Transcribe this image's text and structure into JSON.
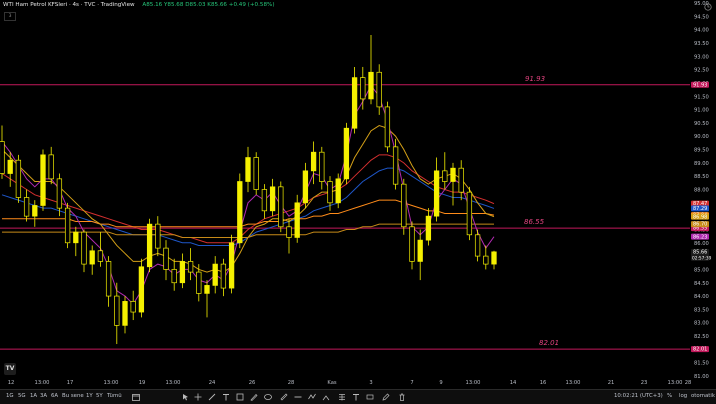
{
  "chart_info": {
    "title": "WTI Ham Petrol KFSleri · 4s · TVC · TradingView",
    "ohlc": "A85.16 Y85.68 D85.03 K85.66 +0.49 (+0.58%)"
  },
  "chart_data": {
    "type": "candlestick",
    "y_range": [
      81.0,
      95.0
    ],
    "y_ticks": [
      "95.00",
      "94.50",
      "94.00",
      "93.50",
      "93.00",
      "92.50",
      "92.00",
      "91.50",
      "91.00",
      "90.50",
      "90.00",
      "89.50",
      "89.00",
      "88.50",
      "88.00",
      "87.50",
      "87.00",
      "86.50",
      "86.00",
      "85.50",
      "85.00",
      "84.50",
      "84.00",
      "83.50",
      "83.00",
      "82.50",
      "82.00",
      "81.50",
      "81.00"
    ],
    "x_ticks": [
      "12",
      "13:00",
      "17",
      "13:00",
      "19",
      "13:00",
      "24",
      "26",
      "28",
      "Kas",
      "3",
      "7",
      "9",
      "13:00",
      "14",
      "16",
      "13:00",
      "21",
      "23",
      "13:00",
      "28"
    ],
    "horizontal_levels": [
      {
        "label": "91.93",
        "value": 91.93
      },
      {
        "label": "86.55",
        "value": 86.55
      },
      {
        "label": "82.01",
        "value": 82.01
      }
    ],
    "price_tags": [
      {
        "label": "87.47",
        "value": 87.47,
        "color": "#d32f2f"
      },
      {
        "label": "87.29",
        "value": 87.29,
        "color": "#1e56c8"
      },
      {
        "label": "87.04",
        "value": 87.04,
        "color": "#ff8c1a"
      },
      {
        "label": "86.98",
        "value": 86.98,
        "color": "#d4a017"
      },
      {
        "label": "86.70",
        "value": 86.7,
        "color": "#c78b18"
      },
      {
        "label": "86.23",
        "value": 86.23,
        "color": "#b02ab0"
      }
    ],
    "last_price": {
      "label": "85.66",
      "countdown": "02:57:39",
      "value": 85.66
    },
    "candles": [
      {
        "o": 89.8,
        "h": 90.4,
        "l": 88.4,
        "c": 88.6
      },
      {
        "o": 88.6,
        "h": 89.4,
        "l": 88.1,
        "c": 89.1
      },
      {
        "o": 89.1,
        "h": 89.3,
        "l": 87.5,
        "c": 87.7
      },
      {
        "o": 87.7,
        "h": 88.0,
        "l": 86.8,
        "c": 87.0
      },
      {
        "o": 87.0,
        "h": 87.6,
        "l": 86.6,
        "c": 87.4
      },
      {
        "o": 87.4,
        "h": 89.5,
        "l": 87.2,
        "c": 89.3
      },
      {
        "o": 89.3,
        "h": 89.6,
        "l": 88.2,
        "c": 88.4
      },
      {
        "o": 88.4,
        "h": 88.6,
        "l": 87.0,
        "c": 87.3
      },
      {
        "o": 87.3,
        "h": 87.5,
        "l": 85.8,
        "c": 86.0
      },
      {
        "o": 86.0,
        "h": 86.6,
        "l": 85.5,
        "c": 86.4
      },
      {
        "o": 86.4,
        "h": 86.5,
        "l": 84.9,
        "c": 85.2
      },
      {
        "o": 85.2,
        "h": 85.9,
        "l": 84.8,
        "c": 85.7
      },
      {
        "o": 85.7,
        "h": 86.4,
        "l": 85.1,
        "c": 85.3
      },
      {
        "o": 85.3,
        "h": 85.5,
        "l": 83.6,
        "c": 84.0
      },
      {
        "o": 84.0,
        "h": 84.5,
        "l": 82.2,
        "c": 82.9
      },
      {
        "o": 82.9,
        "h": 84.0,
        "l": 82.6,
        "c": 83.8
      },
      {
        "o": 83.8,
        "h": 84.2,
        "l": 83.1,
        "c": 83.4
      },
      {
        "o": 83.4,
        "h": 85.4,
        "l": 83.2,
        "c": 85.1
      },
      {
        "o": 85.1,
        "h": 86.9,
        "l": 84.9,
        "c": 86.7
      },
      {
        "o": 86.7,
        "h": 87.0,
        "l": 85.5,
        "c": 85.8
      },
      {
        "o": 85.8,
        "h": 86.1,
        "l": 84.6,
        "c": 85.0
      },
      {
        "o": 85.0,
        "h": 85.4,
        "l": 84.2,
        "c": 84.5
      },
      {
        "o": 84.5,
        "h": 85.6,
        "l": 84.3,
        "c": 85.3
      },
      {
        "o": 85.3,
        "h": 85.8,
        "l": 84.6,
        "c": 84.9
      },
      {
        "o": 84.9,
        "h": 85.2,
        "l": 83.8,
        "c": 84.1
      },
      {
        "o": 84.1,
        "h": 84.6,
        "l": 83.2,
        "c": 84.4
      },
      {
        "o": 84.4,
        "h": 85.5,
        "l": 84.1,
        "c": 85.2
      },
      {
        "o": 85.2,
        "h": 85.4,
        "l": 84.0,
        "c": 84.3
      },
      {
        "o": 84.3,
        "h": 86.3,
        "l": 84.1,
        "c": 86.0
      },
      {
        "o": 86.0,
        "h": 88.6,
        "l": 85.8,
        "c": 88.3
      },
      {
        "o": 88.3,
        "h": 89.6,
        "l": 87.9,
        "c": 89.2
      },
      {
        "o": 89.2,
        "h": 89.4,
        "l": 87.8,
        "c": 88.0
      },
      {
        "o": 88.0,
        "h": 88.2,
        "l": 86.9,
        "c": 87.2
      },
      {
        "o": 87.2,
        "h": 88.4,
        "l": 87.0,
        "c": 88.1
      },
      {
        "o": 88.1,
        "h": 88.3,
        "l": 86.4,
        "c": 86.6
      },
      {
        "o": 86.6,
        "h": 86.9,
        "l": 85.6,
        "c": 86.2
      },
      {
        "o": 86.2,
        "h": 87.8,
        "l": 86.0,
        "c": 87.5
      },
      {
        "o": 87.5,
        "h": 89.0,
        "l": 87.3,
        "c": 88.7
      },
      {
        "o": 88.7,
        "h": 89.8,
        "l": 88.2,
        "c": 89.4
      },
      {
        "o": 89.4,
        "h": 89.6,
        "l": 88.0,
        "c": 88.3
      },
      {
        "o": 88.3,
        "h": 88.5,
        "l": 87.2,
        "c": 87.5
      },
      {
        "o": 87.5,
        "h": 88.6,
        "l": 87.3,
        "c": 88.4
      },
      {
        "o": 88.4,
        "h": 90.5,
        "l": 88.2,
        "c": 90.3
      },
      {
        "o": 90.3,
        "h": 92.6,
        "l": 90.1,
        "c": 92.2
      },
      {
        "o": 92.2,
        "h": 92.6,
        "l": 91.0,
        "c": 91.4
      },
      {
        "o": 91.4,
        "h": 93.8,
        "l": 91.2,
        "c": 92.4
      },
      {
        "o": 92.4,
        "h": 92.7,
        "l": 90.8,
        "c": 91.1
      },
      {
        "o": 91.1,
        "h": 91.3,
        "l": 89.4,
        "c": 89.6
      },
      {
        "o": 89.6,
        "h": 89.9,
        "l": 88.0,
        "c": 88.2
      },
      {
        "o": 88.2,
        "h": 88.4,
        "l": 86.3,
        "c": 86.6
      },
      {
        "o": 86.6,
        "h": 86.8,
        "l": 85.0,
        "c": 85.3
      },
      {
        "o": 85.3,
        "h": 86.5,
        "l": 84.6,
        "c": 86.1
      },
      {
        "o": 86.1,
        "h": 87.3,
        "l": 85.9,
        "c": 87.0
      },
      {
        "o": 87.0,
        "h": 89.2,
        "l": 86.8,
        "c": 88.7
      },
      {
        "o": 88.7,
        "h": 89.4,
        "l": 88.0,
        "c": 88.3
      },
      {
        "o": 88.3,
        "h": 89.0,
        "l": 87.4,
        "c": 88.8
      },
      {
        "o": 88.8,
        "h": 89.1,
        "l": 87.6,
        "c": 87.9
      },
      {
        "o": 87.9,
        "h": 88.1,
        "l": 86.1,
        "c": 86.3
      },
      {
        "o": 86.3,
        "h": 86.5,
        "l": 85.3,
        "c": 85.5
      },
      {
        "o": 85.5,
        "h": 85.9,
        "l": 85.0,
        "c": 85.2
      },
      {
        "o": 85.2,
        "h": 85.7,
        "l": 85.0,
        "c": 85.66
      }
    ],
    "moving_averages": [
      {
        "color": "#d32f2f",
        "values": [
          88.6,
          88.4,
          88.2,
          88.0,
          87.8,
          87.7,
          87.6,
          87.5,
          87.4,
          87.3,
          87.2,
          87.1,
          87.0,
          86.9,
          86.8,
          86.7,
          86.6,
          86.5,
          86.5,
          86.5,
          86.4,
          86.3,
          86.2,
          86.2,
          86.1,
          86.0,
          86.0,
          86.0,
          86.0,
          86.2,
          86.5,
          86.7,
          86.9,
          87.0,
          87.1,
          87.2,
          87.3,
          87.5,
          87.7,
          87.8,
          87.9,
          88.0,
          88.2,
          88.5,
          88.8,
          89.1,
          89.3,
          89.3,
          89.2,
          89.0,
          88.7,
          88.5,
          88.3,
          88.1,
          88.0,
          87.9,
          87.9,
          87.8,
          87.7,
          87.6,
          87.47
        ]
      },
      {
        "color": "#1e56c8",
        "values": [
          87.8,
          87.7,
          87.6,
          87.5,
          87.4,
          87.3,
          87.3,
          87.2,
          87.1,
          87.0,
          86.9,
          86.8,
          86.7,
          86.6,
          86.5,
          86.4,
          86.3,
          86.3,
          86.3,
          86.3,
          86.2,
          86.1,
          86.0,
          86.0,
          85.9,
          85.9,
          85.9,
          85.9,
          85.9,
          86.0,
          86.2,
          86.4,
          86.5,
          86.6,
          86.7,
          86.8,
          86.9,
          87.0,
          87.2,
          87.3,
          87.4,
          87.5,
          87.7,
          88.0,
          88.3,
          88.5,
          88.7,
          88.8,
          88.8,
          88.7,
          88.5,
          88.3,
          88.1,
          87.9,
          87.8,
          87.7,
          87.7,
          87.6,
          87.5,
          87.4,
          87.29
        ]
      },
      {
        "color": "#ff8c1a",
        "values": [
          86.9,
          86.9,
          86.9,
          86.9,
          86.9,
          86.9,
          86.9,
          86.9,
          86.9,
          86.8,
          86.8,
          86.8,
          86.7,
          86.7,
          86.6,
          86.6,
          86.6,
          86.6,
          86.6,
          86.6,
          86.6,
          86.6,
          86.6,
          86.6,
          86.6,
          86.6,
          86.6,
          86.6,
          86.6,
          86.6,
          86.7,
          86.7,
          86.8,
          86.8,
          86.8,
          86.9,
          86.9,
          86.9,
          87.0,
          87.0,
          87.1,
          87.1,
          87.2,
          87.3,
          87.4,
          87.5,
          87.6,
          87.6,
          87.6,
          87.5,
          87.4,
          87.3,
          87.2,
          87.2,
          87.1,
          87.1,
          87.1,
          87.1,
          87.1,
          87.1,
          87.04
        ]
      },
      {
        "color": "#d4a017",
        "values": [
          89.5,
          89.2,
          88.9,
          88.6,
          88.3,
          88.3,
          88.3,
          88.1,
          87.8,
          87.5,
          87.2,
          86.9,
          86.7,
          86.3,
          85.9,
          85.6,
          85.3,
          85.3,
          85.5,
          85.6,
          85.5,
          85.3,
          85.3,
          85.2,
          85.0,
          84.9,
          85.0,
          84.9,
          85.1,
          85.6,
          86.2,
          86.6,
          86.7,
          86.9,
          86.9,
          86.8,
          87.0,
          87.3,
          87.7,
          87.9,
          87.9,
          88.0,
          88.5,
          89.2,
          89.7,
          90.2,
          90.4,
          90.3,
          90.0,
          89.5,
          88.9,
          88.4,
          88.2,
          88.4,
          88.5,
          88.6,
          88.4,
          88.0,
          87.5,
          87.1,
          86.98
        ]
      },
      {
        "color": "#c78b18",
        "values": [
          86.4,
          86.4,
          86.4,
          86.4,
          86.4,
          86.4,
          86.4,
          86.4,
          86.4,
          86.4,
          86.4,
          86.4,
          86.4,
          86.4,
          86.3,
          86.3,
          86.3,
          86.3,
          86.3,
          86.3,
          86.3,
          86.3,
          86.2,
          86.2,
          86.2,
          86.2,
          86.2,
          86.2,
          86.2,
          86.2,
          86.2,
          86.3,
          86.3,
          86.3,
          86.3,
          86.3,
          86.3,
          86.3,
          86.4,
          86.4,
          86.4,
          86.4,
          86.5,
          86.5,
          86.6,
          86.6,
          86.7,
          86.7,
          86.7,
          86.7,
          86.7,
          86.7,
          86.7,
          86.7,
          86.7,
          86.7,
          86.7,
          86.7,
          86.7,
          86.7,
          86.7
        ]
      },
      {
        "color": "#b02ab0",
        "values": [
          89.8,
          89.4,
          88.9,
          88.4,
          88.1,
          88.4,
          88.4,
          88.0,
          87.3,
          87.0,
          86.4,
          86.1,
          85.8,
          85.1,
          84.2,
          84.0,
          83.7,
          84.2,
          85.0,
          85.2,
          85.1,
          84.8,
          85.0,
          85.0,
          84.6,
          84.5,
          84.8,
          84.6,
          85.2,
          86.4,
          87.5,
          87.8,
          87.6,
          87.9,
          87.4,
          87.0,
          87.2,
          87.9,
          88.6,
          88.5,
          88.0,
          88.2,
          89.3,
          90.8,
          91.3,
          91.9,
          91.5,
          90.6,
          89.4,
          88.0,
          86.6,
          86.3,
          86.6,
          87.6,
          88.0,
          88.4,
          88.2,
          87.3,
          86.4,
          85.8,
          86.23
        ]
      }
    ]
  },
  "bottom_bar": {
    "timeframes": [
      "1G",
      "5G",
      "1A",
      "3A",
      "6A",
      "Bu sene",
      "1Y",
      "5Y",
      "Tümü"
    ],
    "time": "10:02:21 (UTC+3)",
    "right_items": [
      "%",
      "log",
      "otomatik"
    ]
  },
  "header": {
    "collapse_label": "3"
  }
}
